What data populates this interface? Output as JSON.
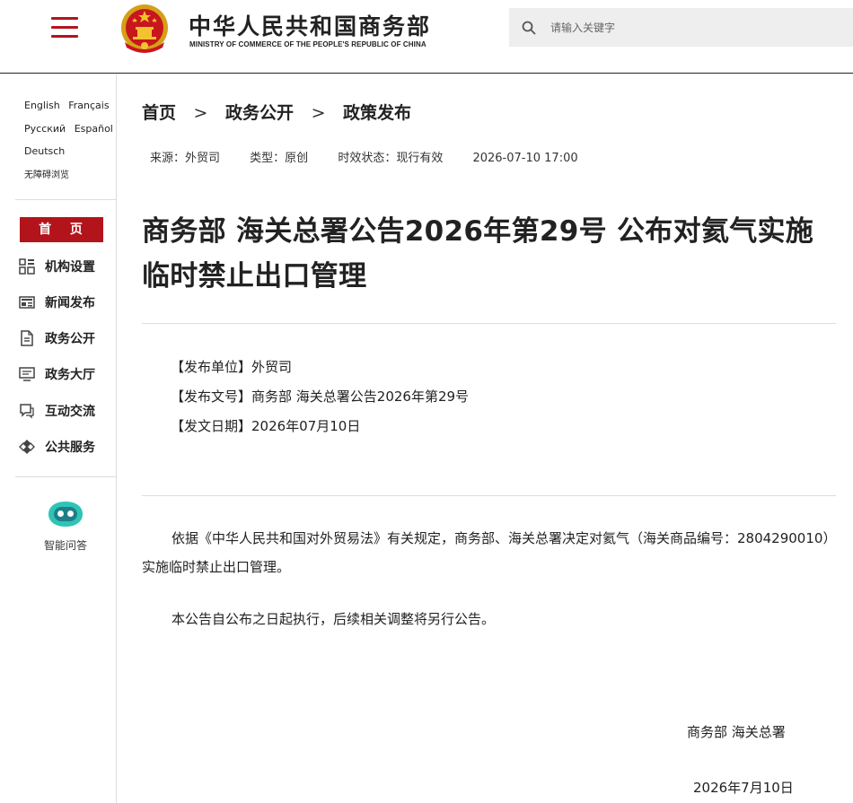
{
  "header": {
    "brand_cn": "中华人民共和国商务部",
    "brand_en": "MINISTRY OF COMMERCE OF THE PEOPLE'S REPUBLIC OF CHINA",
    "search_placeholder": "请输入关键字",
    "accent_color": "#b3141b"
  },
  "sidebar": {
    "languages": [
      "English",
      "Français",
      "Русский",
      "Español",
      "Deutsch",
      "无障碍浏览"
    ],
    "home_label": "首 页",
    "nav_items": [
      {
        "label": "机构设置",
        "icon": "org-structure-icon"
      },
      {
        "label": "新闻发布",
        "icon": "news-icon"
      },
      {
        "label": "政务公开",
        "icon": "document-icon"
      },
      {
        "label": "政务大厅",
        "icon": "monitor-icon"
      },
      {
        "label": "互动交流",
        "icon": "chat-icon"
      },
      {
        "label": "公共服务",
        "icon": "service-icon"
      }
    ],
    "ai_label": "智能问答"
  },
  "breadcrumb": {
    "items": [
      "首页",
      "政务公开",
      "政策发布"
    ],
    "separator": ">"
  },
  "meta": {
    "source": "来源：外贸司",
    "type": "类型：原创",
    "status": "时效状态：现行有效",
    "datetime": "2026-07-10 17:00"
  },
  "article": {
    "title": "商务部 海关总署公告2026年第29号 公布对氦气实施临时禁止出口管理",
    "issuer": "【发布单位】外贸司",
    "doc_number": "【发布文号】商务部 海关总署公告2026年第29号",
    "doc_date": "【发文日期】2026年07月10日",
    "paragraphs": [
      "依据《中华人民共和国对外贸易法》有关规定，商务部、海关总署决定对氦气（海关商品编号：2804290010）实施临时禁止出口管理。",
      "本公告自公布之日起执行，后续相关调整将另行公告。"
    ],
    "signature_org": "商务部 海关总署",
    "signature_date": "2026年7月10日"
  }
}
